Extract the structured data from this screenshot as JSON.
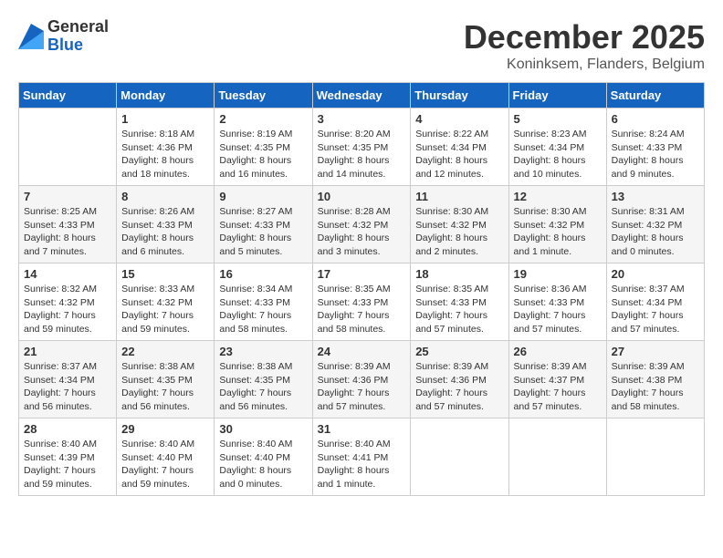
{
  "logo": {
    "general": "General",
    "blue": "Blue"
  },
  "title": "December 2025",
  "subtitle": "Koninksem, Flanders, Belgium",
  "days_header": [
    "Sunday",
    "Monday",
    "Tuesday",
    "Wednesday",
    "Thursday",
    "Friday",
    "Saturday"
  ],
  "weeks": [
    [
      {
        "num": "",
        "info": ""
      },
      {
        "num": "1",
        "info": "Sunrise: 8:18 AM\nSunset: 4:36 PM\nDaylight: 8 hours\nand 18 minutes."
      },
      {
        "num": "2",
        "info": "Sunrise: 8:19 AM\nSunset: 4:35 PM\nDaylight: 8 hours\nand 16 minutes."
      },
      {
        "num": "3",
        "info": "Sunrise: 8:20 AM\nSunset: 4:35 PM\nDaylight: 8 hours\nand 14 minutes."
      },
      {
        "num": "4",
        "info": "Sunrise: 8:22 AM\nSunset: 4:34 PM\nDaylight: 8 hours\nand 12 minutes."
      },
      {
        "num": "5",
        "info": "Sunrise: 8:23 AM\nSunset: 4:34 PM\nDaylight: 8 hours\nand 10 minutes."
      },
      {
        "num": "6",
        "info": "Sunrise: 8:24 AM\nSunset: 4:33 PM\nDaylight: 8 hours\nand 9 minutes."
      }
    ],
    [
      {
        "num": "7",
        "info": "Sunrise: 8:25 AM\nSunset: 4:33 PM\nDaylight: 8 hours\nand 7 minutes."
      },
      {
        "num": "8",
        "info": "Sunrise: 8:26 AM\nSunset: 4:33 PM\nDaylight: 8 hours\nand 6 minutes."
      },
      {
        "num": "9",
        "info": "Sunrise: 8:27 AM\nSunset: 4:33 PM\nDaylight: 8 hours\nand 5 minutes."
      },
      {
        "num": "10",
        "info": "Sunrise: 8:28 AM\nSunset: 4:32 PM\nDaylight: 8 hours\nand 3 minutes."
      },
      {
        "num": "11",
        "info": "Sunrise: 8:30 AM\nSunset: 4:32 PM\nDaylight: 8 hours\nand 2 minutes."
      },
      {
        "num": "12",
        "info": "Sunrise: 8:30 AM\nSunset: 4:32 PM\nDaylight: 8 hours\nand 1 minute."
      },
      {
        "num": "13",
        "info": "Sunrise: 8:31 AM\nSunset: 4:32 PM\nDaylight: 8 hours\nand 0 minutes."
      }
    ],
    [
      {
        "num": "14",
        "info": "Sunrise: 8:32 AM\nSunset: 4:32 PM\nDaylight: 7 hours\nand 59 minutes."
      },
      {
        "num": "15",
        "info": "Sunrise: 8:33 AM\nSunset: 4:32 PM\nDaylight: 7 hours\nand 59 minutes."
      },
      {
        "num": "16",
        "info": "Sunrise: 8:34 AM\nSunset: 4:33 PM\nDaylight: 7 hours\nand 58 minutes."
      },
      {
        "num": "17",
        "info": "Sunrise: 8:35 AM\nSunset: 4:33 PM\nDaylight: 7 hours\nand 58 minutes."
      },
      {
        "num": "18",
        "info": "Sunrise: 8:35 AM\nSunset: 4:33 PM\nDaylight: 7 hours\nand 57 minutes."
      },
      {
        "num": "19",
        "info": "Sunrise: 8:36 AM\nSunset: 4:33 PM\nDaylight: 7 hours\nand 57 minutes."
      },
      {
        "num": "20",
        "info": "Sunrise: 8:37 AM\nSunset: 4:34 PM\nDaylight: 7 hours\nand 57 minutes."
      }
    ],
    [
      {
        "num": "21",
        "info": "Sunrise: 8:37 AM\nSunset: 4:34 PM\nDaylight: 7 hours\nand 56 minutes."
      },
      {
        "num": "22",
        "info": "Sunrise: 8:38 AM\nSunset: 4:35 PM\nDaylight: 7 hours\nand 56 minutes."
      },
      {
        "num": "23",
        "info": "Sunrise: 8:38 AM\nSunset: 4:35 PM\nDaylight: 7 hours\nand 56 minutes."
      },
      {
        "num": "24",
        "info": "Sunrise: 8:39 AM\nSunset: 4:36 PM\nDaylight: 7 hours\nand 57 minutes."
      },
      {
        "num": "25",
        "info": "Sunrise: 8:39 AM\nSunset: 4:36 PM\nDaylight: 7 hours\nand 57 minutes."
      },
      {
        "num": "26",
        "info": "Sunrise: 8:39 AM\nSunset: 4:37 PM\nDaylight: 7 hours\nand 57 minutes."
      },
      {
        "num": "27",
        "info": "Sunrise: 8:39 AM\nSunset: 4:38 PM\nDaylight: 7 hours\nand 58 minutes."
      }
    ],
    [
      {
        "num": "28",
        "info": "Sunrise: 8:40 AM\nSunset: 4:39 PM\nDaylight: 7 hours\nand 59 minutes."
      },
      {
        "num": "29",
        "info": "Sunrise: 8:40 AM\nSunset: 4:40 PM\nDaylight: 7 hours\nand 59 minutes."
      },
      {
        "num": "30",
        "info": "Sunrise: 8:40 AM\nSunset: 4:40 PM\nDaylight: 8 hours\nand 0 minutes."
      },
      {
        "num": "31",
        "info": "Sunrise: 8:40 AM\nSunset: 4:41 PM\nDaylight: 8 hours\nand 1 minute."
      },
      {
        "num": "",
        "info": ""
      },
      {
        "num": "",
        "info": ""
      },
      {
        "num": "",
        "info": ""
      }
    ]
  ]
}
